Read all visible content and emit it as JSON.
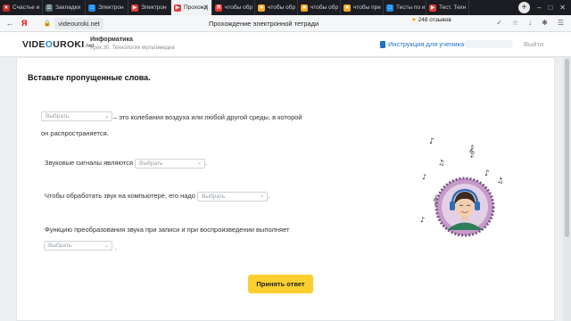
{
  "browser": {
    "tabs": [
      {
        "label": "Счастье и",
        "icon": "star-icon",
        "color": "#c62828",
        "active": false
      },
      {
        "label": "Закладки",
        "icon": "bookmarks-icon",
        "color": "#546e7a",
        "active": false
      },
      {
        "label": "Электрон",
        "icon": "page-icon",
        "color": "#1e88e5",
        "active": false
      },
      {
        "label": "Электрон",
        "icon": "videouroki-icon",
        "color": "#e53935",
        "active": false
      },
      {
        "label": "Прохожд",
        "icon": "videouroki-icon",
        "color": "#e53935",
        "active": true
      },
      {
        "label": "чтобы обр",
        "icon": "yandex-icon",
        "color": "#e53935",
        "active": false
      },
      {
        "label": "чтобы обр",
        "icon": "folder-icon",
        "color": "#f9a825",
        "active": false
      },
      {
        "label": "чтобы обр",
        "icon": "folder-icon",
        "color": "#f9a825",
        "active": false
      },
      {
        "label": "чтобы пре",
        "icon": "folder-icon",
        "color": "#f9a825",
        "active": false
      },
      {
        "label": "Тесты по и",
        "icon": "page-icon",
        "color": "#1e88e5",
        "active": false
      },
      {
        "label": "Тест. Техн",
        "icon": "videouroki-icon",
        "color": "#e53935",
        "active": false
      }
    ],
    "address": {
      "host": "videouroki.net",
      "page_title": "Прохождение электронной тетради",
      "reviews_count": "248 отзывов",
      "yandex_label": "Я"
    }
  },
  "site": {
    "logo_prefix": "VIDE",
    "logo_o": "O",
    "logo_suffix": "UROKI",
    "logo_tld": ".net",
    "subject": "Информатика",
    "lesson": "Урок 30. Технология мультимедиа",
    "instruction_link": "Инструкция для ученика",
    "logout": "Выйти"
  },
  "task": {
    "heading": "Вставьте пропущенные слова.",
    "q1_text_a": "– это колебания воздуха или любой другой среды, в которой",
    "q1_text_b": "он распространяется.",
    "q2_text": "Звуковые сигналы являются",
    "q3_text": "Чтобы обработать звук на компьютере, его надо",
    "q4_text": "Функцию преобразования звука при записи и при воспроизведении выполняет",
    "select_placeholder": "Выбрать",
    "punct_dot": ".",
    "submit_label": "Принять ответ"
  },
  "colors": {
    "accent": "#fbcf2f",
    "link": "#1e73c8",
    "logo_o": "#1e88e5"
  }
}
